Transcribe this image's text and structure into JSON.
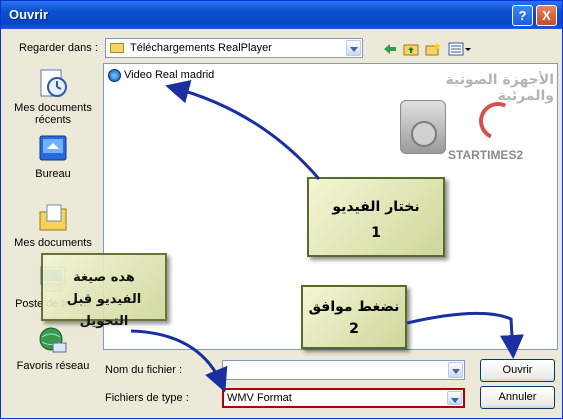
{
  "window": {
    "title": "Ouvrir"
  },
  "title_buttons": {
    "help": "?",
    "close": "X"
  },
  "toolbar": {
    "look_in_label": "Regarder dans :",
    "look_in_value": "Téléchargements RealPlayer"
  },
  "places": [
    {
      "label": "Mes documents récents"
    },
    {
      "label": "Bureau"
    },
    {
      "label": "Mes documents"
    },
    {
      "label": "Poste de travail"
    },
    {
      "label": "Favoris réseau"
    }
  ],
  "files": [
    {
      "name": "Video Real madrid"
    }
  ],
  "watermark": {
    "line1": "الأجهزة الصوتية والمرئية",
    "brand": "STARTIMES2"
  },
  "filename": {
    "label": "Nom du fichier :",
    "value": ""
  },
  "filetype": {
    "label": "Fichiers de type :",
    "value": "WMV Format"
  },
  "buttons": {
    "open": "Ouvrir",
    "cancel": "Annuler"
  },
  "annotations": [
    {
      "text": "نختار الفيديو",
      "number": "1"
    },
    {
      "text": "نضغط موافق",
      "number": "2"
    },
    {
      "text": "هده صيغة الفيديو قبل التحويل"
    }
  ],
  "colors": {
    "arrow": "#1c2fa0",
    "highlight": "#b00000",
    "title_bar": "#0a4fd0"
  }
}
